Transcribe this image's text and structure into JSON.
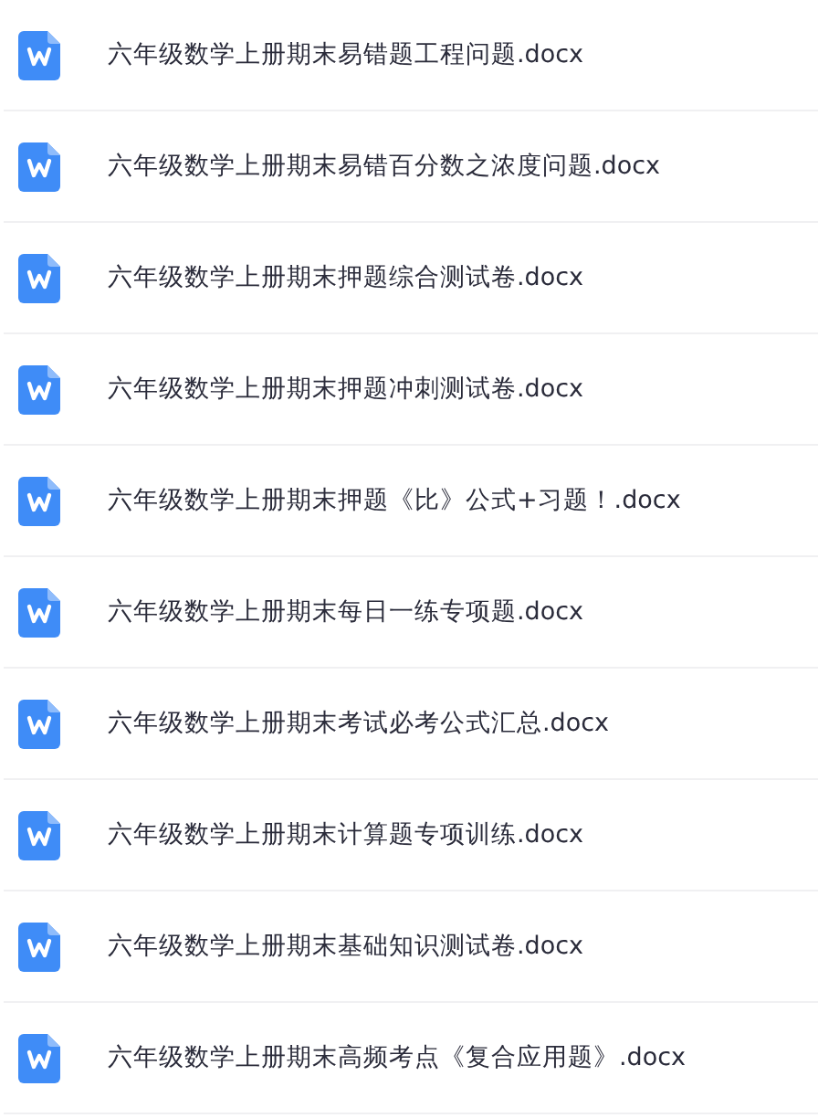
{
  "files": [
    {
      "name": "六年级数学上册期末易错题工程问题.docx"
    },
    {
      "name": "六年级数学上册期末易错百分数之浓度问题.docx"
    },
    {
      "name": "六年级数学上册期末押题综合测试卷.docx"
    },
    {
      "name": "六年级数学上册期末押题冲刺测试卷.docx"
    },
    {
      "name": "六年级数学上册期末押题《比》公式+习题！.docx"
    },
    {
      "name": "六年级数学上册期末每日一练专项题.docx"
    },
    {
      "name": "六年级数学上册期末考试必考公式汇总.docx"
    },
    {
      "name": "六年级数学上册期末计算题专项训练.docx"
    },
    {
      "name": "六年级数学上册期末基础知识测试卷.docx"
    },
    {
      "name": "六年级数学上册期末高频考点《复合应用题》.docx"
    }
  ]
}
